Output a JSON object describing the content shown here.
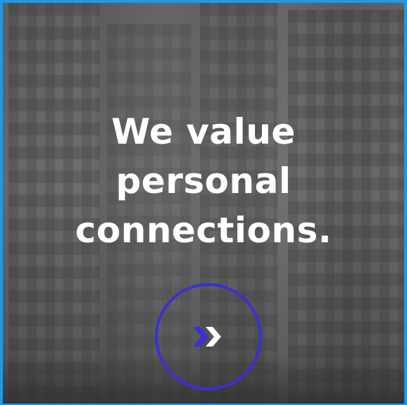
{
  "hero": {
    "headline_lines": [
      "We value",
      "personal",
      "connections."
    ]
  },
  "next_button": {
    "icon": "double-chevron-right-icon"
  },
  "colors": {
    "frame_border": "#1a9bea",
    "button_ring": "#3c2fd6",
    "chevron_left": "#3c2fd6",
    "chevron_right": "#ffffff",
    "headline_text": "#ffffff"
  }
}
